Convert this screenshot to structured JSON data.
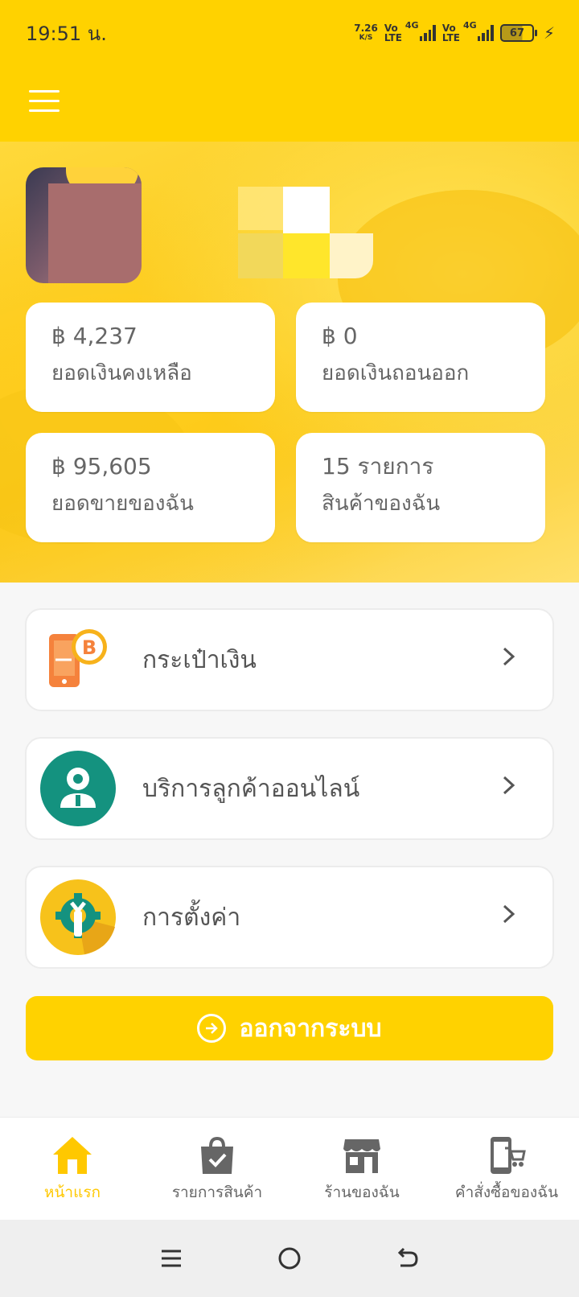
{
  "status_bar": {
    "time": "19:51 น.",
    "net_speed_value": "7.26",
    "net_speed_unit": "K/S",
    "volte1_top": "Vo",
    "volte1_bottom": "LTE",
    "net1": "4G",
    "volte2_top": "Vo",
    "volte2_bottom": "LTE",
    "net2": "4G",
    "battery": "67"
  },
  "header": {
    "menu_icon": "hamburger-icon"
  },
  "stats": [
    {
      "value": "฿ 4,237",
      "label": "ยอดเงินคงเหลือ"
    },
    {
      "value": "฿ 0",
      "label": "ยอดเงินถอนออก"
    },
    {
      "value": "฿ 95,605",
      "label": "ยอดขายของฉัน"
    },
    {
      "value": "15 รายการ",
      "label": "สินค้าของฉัน"
    }
  ],
  "menu": [
    {
      "label": "กระเป๋าเงิน",
      "icon": "wallet-bitcoin-icon"
    },
    {
      "label": "บริการลูกค้าออนไลน์",
      "icon": "customer-service-icon"
    },
    {
      "label": "การตั้งค่า",
      "icon": "settings-gear-icon"
    }
  ],
  "logout": {
    "label": "ออกจากระบบ"
  },
  "bottom_nav": [
    {
      "label": "หน้าแรก",
      "icon": "home-icon",
      "active": true
    },
    {
      "label": "รายการสินค้า",
      "icon": "shopping-bag-icon",
      "active": false
    },
    {
      "label": "ร้านของฉัน",
      "icon": "store-icon",
      "active": false
    },
    {
      "label": "คำสั่งซื้อของฉัน",
      "icon": "mobile-cart-icon",
      "active": false
    }
  ],
  "colors": {
    "accent": "#ffd200",
    "active_nav": "#ffc800",
    "teal": "#14927f",
    "orange": "#f5823c"
  }
}
